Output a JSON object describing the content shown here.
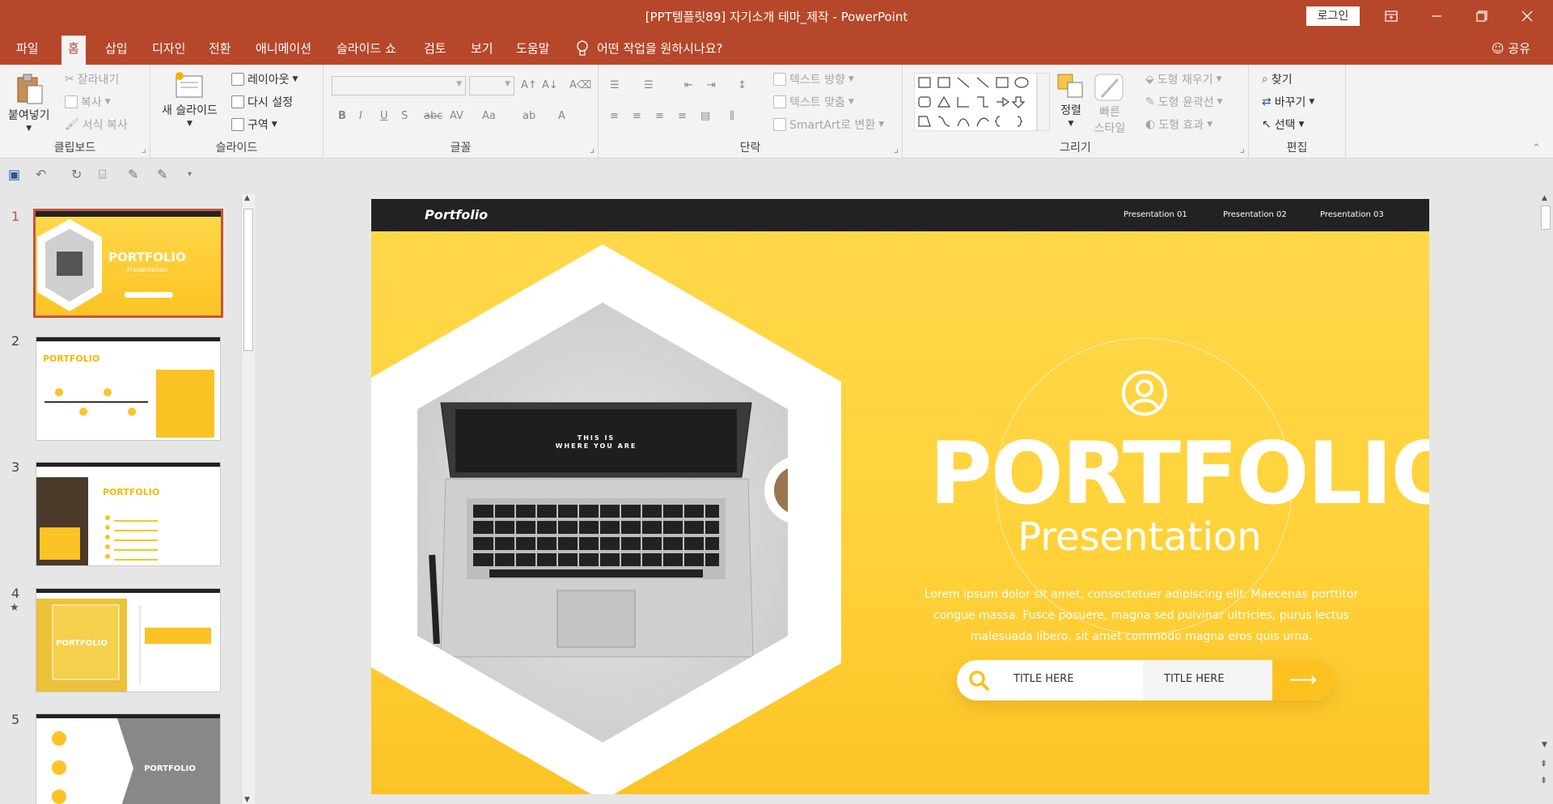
{
  "titlebar": {
    "title": "[PPT템플릿89] 자기소개 테마_제작  -  PowerPoint",
    "login": "로그인",
    "bg": "#b7472a"
  },
  "menu": {
    "tabs": [
      "파일",
      "홈",
      "삽입",
      "디자인",
      "전환",
      "애니메이션",
      "슬라이드 쇼",
      "검토",
      "보기",
      "도움말"
    ],
    "active": "홈",
    "tell": "어떤 작업을 원하시나요?",
    "share": "공유"
  },
  "ribbon": {
    "clipboard": {
      "paste": "붙여넣기",
      "cut": "잘라내기",
      "copy": "복사",
      "format_painter": "서식 복사",
      "label": "클립보드"
    },
    "slides": {
      "new_slide": "새 슬라이드",
      "layout": "레이아웃",
      "reset": "다시 설정",
      "section": "구역",
      "label": "슬라이드"
    },
    "font": {
      "label": "글꼴"
    },
    "paragraph": {
      "text_direction": "텍스트 방향",
      "align_text": "텍스트 맞춤",
      "smartart": "SmartArt로 변환",
      "label": "단락"
    },
    "drawing": {
      "arrange": "정렬",
      "quick_styles": "빠른 스타일",
      "fill": "도형 채우기",
      "outline": "도형 윤곽선",
      "effects": "도형 효과",
      "label": "그리기"
    },
    "editing": {
      "find": "찾기",
      "replace": "바꾸기",
      "select": "선택",
      "label": "편집"
    }
  },
  "thumbnails": {
    "numbers": [
      "1",
      "2",
      "3",
      "4",
      "5"
    ]
  },
  "slide": {
    "brand": "Portfolio",
    "nav": [
      "Presentation 01",
      "Presentation 02",
      "Presentation 03"
    ],
    "title": "PORTFOLIO",
    "subtitle": "Presentation",
    "lorem": "Lorem ipsum dolor sit amet, consectetuer adipiscing elit. Maecenas porttitor congue massa. Fusce posuere, magna sed pulvinar ultricies, purus lectus malesuada libero, sit amet commodo magna eros quis urna.",
    "pill_1": "TITLE HERE",
    "pill_2": "TITLE HERE",
    "screen_text_1": "THIS IS",
    "screen_text_2": "WHERE YOU ARE",
    "accent": "#fcc11f"
  }
}
